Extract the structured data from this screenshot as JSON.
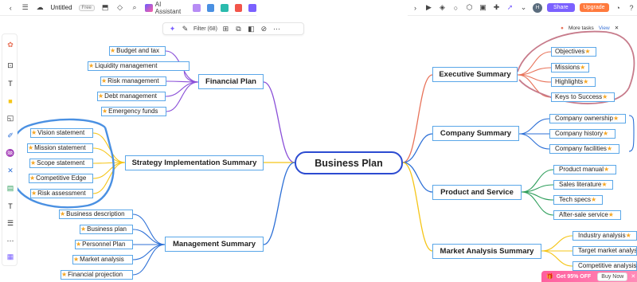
{
  "toolbar": {
    "doc_title": "Untitled",
    "plan_badge": "Free",
    "ai_label": "AI Assistant",
    "share_label": "Share",
    "upgrade_label": "Upgrade",
    "avatar_initial": "H",
    "notification_count": "1",
    "filter_label": "Filter (68)"
  },
  "tasks_panel": {
    "label": "More tasks",
    "view_label": "View"
  },
  "mindmap": {
    "root": "Business Plan",
    "branches": {
      "financial": {
        "title": "Financial Plan",
        "children": [
          "Budget and tax",
          "Liquidity management",
          "Risk management",
          "Debt management",
          "Emergency funds"
        ]
      },
      "strategy": {
        "title": "Strategy Implementation Summary",
        "children": [
          "Vision statement",
          "Mission statement",
          "Scope statement",
          "Competitive Edge",
          "Risk assessment"
        ]
      },
      "management": {
        "title": "Management Summary",
        "children": [
          "Business description",
          "Business plan",
          "Personnel Plan",
          "Market analysis",
          "Financial  projection"
        ]
      },
      "executive": {
        "title": "Executive Summary",
        "children": [
          "Objectives",
          "Missions",
          "Highlights",
          "Keys to Success"
        ]
      },
      "company": {
        "title": "Company Summary",
        "children": [
          "Company ownership",
          "Company history",
          "Company facilities"
        ]
      },
      "product": {
        "title": "Product and Service",
        "children": [
          "Product manual",
          "Sales literature",
          "Tech specs",
          "After-sale service"
        ]
      },
      "market": {
        "title": "Market Analysis Summary",
        "children": [
          "Industry analysis",
          "Target market analysis",
          "Competitive analysis"
        ]
      }
    }
  },
  "promo": {
    "label": "Get 95% OFF",
    "button": "Buy Now"
  },
  "colors": {
    "node_border": "#5aa7e8",
    "root_border": "#2c4bd1",
    "star": "#f5a623",
    "annotation_blue": "#4a90e2",
    "annotation_pink": "#c77b8b"
  }
}
